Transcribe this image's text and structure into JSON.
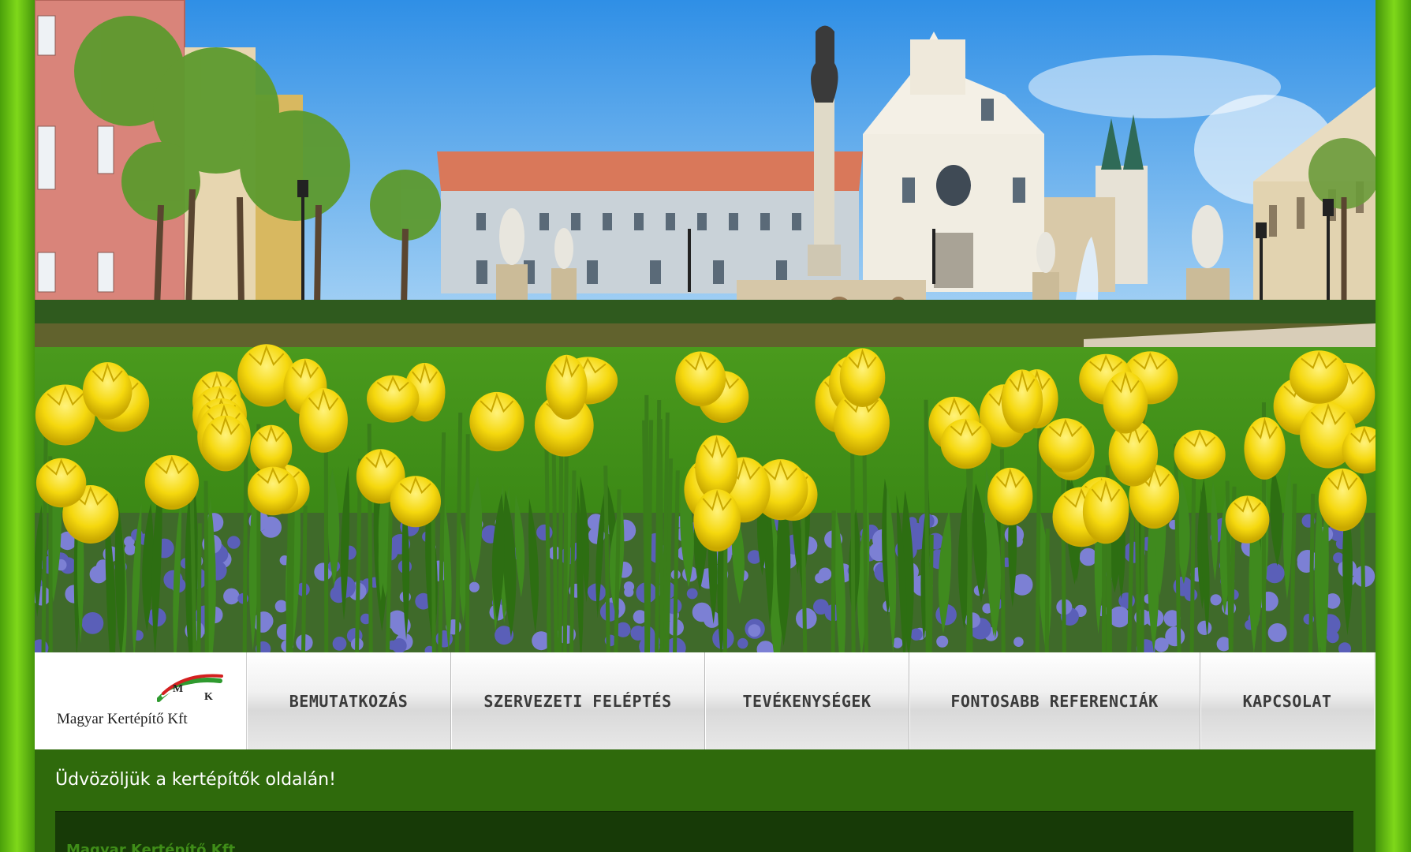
{
  "colors": {
    "outer_bg": "#3f8f0a",
    "page_bg": "#2f6a0c",
    "content_panel_bg": "#173a07",
    "heading_green": "#3f8d18",
    "nav_text": "#3b3b3b"
  },
  "logo": {
    "text": "Magyar Kertépítő Kft",
    "mark_letters": [
      "M",
      "K"
    ]
  },
  "nav": {
    "items": [
      {
        "label": "BEMUTATKOZÁS"
      },
      {
        "label": "SZERVEZETI FELÉPTÉS"
      },
      {
        "label": "TEVÉKENYSÉGEK"
      },
      {
        "label": "FONTOSABB REFERENCIÁK"
      },
      {
        "label": "KAPCSOLAT"
      }
    ]
  },
  "main": {
    "welcome": "Üdvözöljük a kertépítők oldalán!",
    "company_heading": "Magyar Kertépítő Kft"
  }
}
